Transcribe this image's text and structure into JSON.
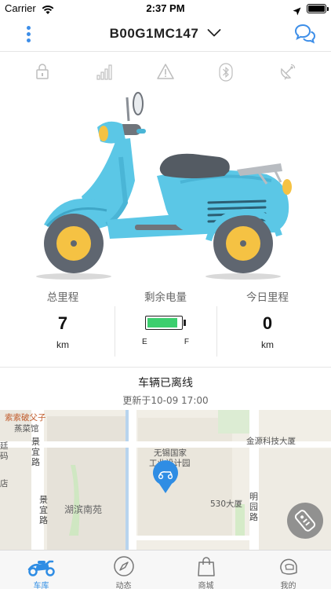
{
  "status_bar": {
    "carrier": "Carrier",
    "time": "2:37 PM"
  },
  "nav": {
    "title": "B00G1MC147"
  },
  "status_icons": [
    "lock-icon",
    "signal-bars-icon",
    "warning-icon",
    "bluetooth-icon",
    "satellite-icon"
  ],
  "vehicle_image": {
    "icon": "scooter-illustration",
    "body_color": "#5bc7e6",
    "wheel_color": "#f5c243"
  },
  "stats": {
    "total_mileage": {
      "label": "总里程",
      "value": "7",
      "unit": "km"
    },
    "battery": {
      "label": "剩余电量",
      "level": 0.9,
      "empty_label": "E",
      "full_label": "F",
      "fill_color": "#3ccf6e"
    },
    "today_mileage": {
      "label": "今日里程",
      "value": "0",
      "unit": "km"
    }
  },
  "connection": {
    "status_text": "车辆已离线",
    "updated_text": "更新于10-09 17:00"
  },
  "map": {
    "labels": {
      "restaurant": "索索破父子",
      "restaurant2": "蒸菜馆",
      "building1": "无锡国家",
      "building2": "工业设计园",
      "jinyuan": "金源科技大厦",
      "tower530": "530大厦",
      "district": "湖滨南苑",
      "road_jingyi_top": "景宜路",
      "road_jingyi_bottom": "景宜路",
      "road_minggang": "明园路",
      "left_edge_1": "廷",
      "left_edge_2": "码",
      "left_edge_3": "店"
    }
  },
  "tabs": [
    {
      "label": "车库",
      "icon": "scooter-icon",
      "active": true
    },
    {
      "label": "动态",
      "icon": "compass-icon",
      "active": false
    },
    {
      "label": "商城",
      "icon": "shopping-bag-icon",
      "active": false
    },
    {
      "label": "我的",
      "icon": "helmet-icon",
      "active": false
    }
  ],
  "colors": {
    "accent": "#2f8de4",
    "divider": "#e6e6e6"
  }
}
